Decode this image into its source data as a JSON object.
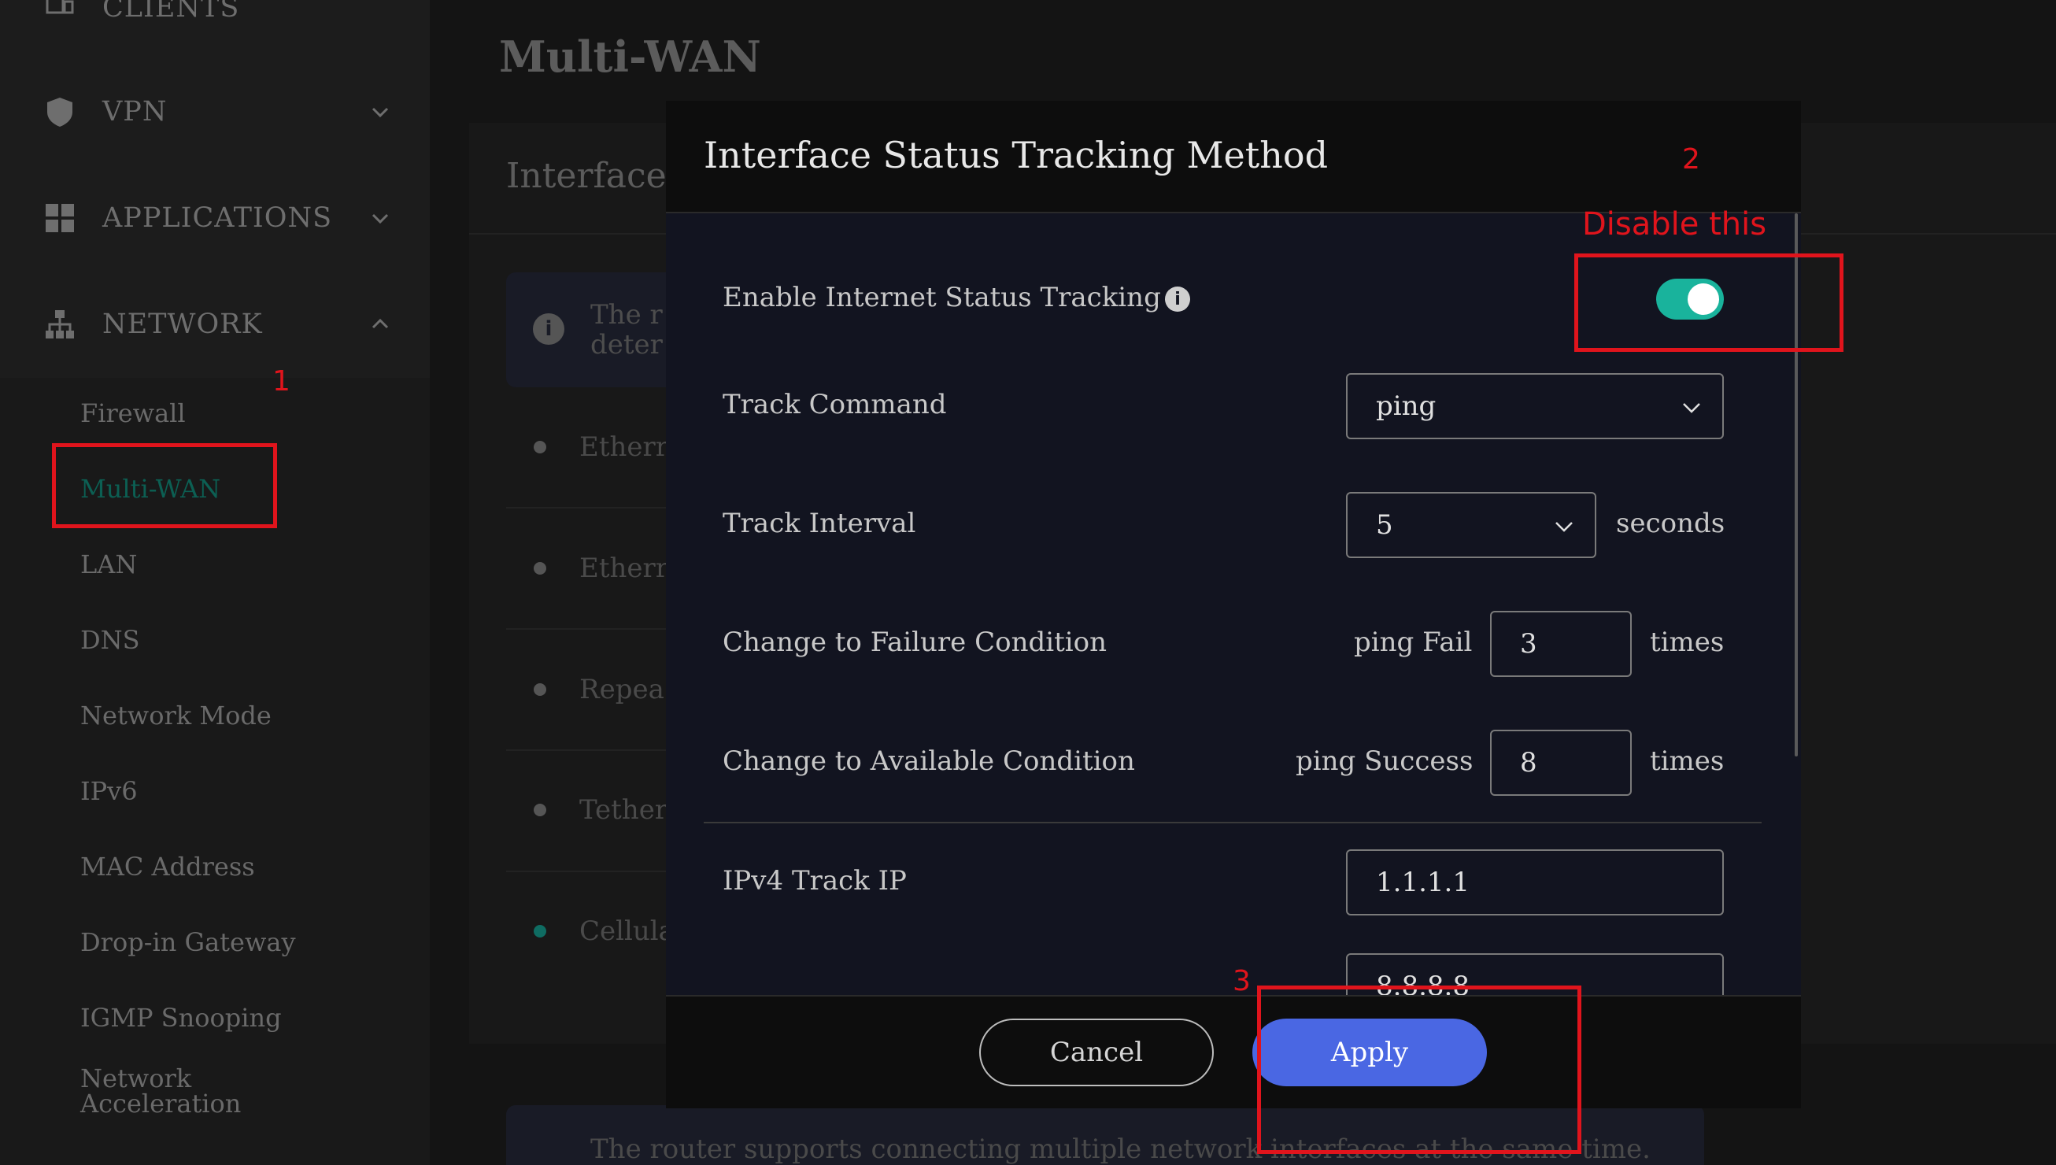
{
  "sidebar": {
    "items": [
      {
        "label": "CLIENTS",
        "icon": "clients-icon"
      },
      {
        "label": "VPN",
        "icon": "shield-icon"
      },
      {
        "label": "APPLICATIONS",
        "icon": "grid-icon"
      },
      {
        "label": "NETWORK",
        "icon": "network-icon"
      }
    ],
    "network_sub": [
      "Firewall",
      "Multi-WAN",
      "LAN",
      "DNS",
      "Network Mode",
      "IPv6",
      "MAC Address",
      "Drop-in Gateway",
      "IGMP Snooping",
      "Network\nAcceleration"
    ]
  },
  "page": {
    "title": "Multi-WAN",
    "panel_title": "Interface",
    "info_text_1": "The r",
    "info_text_2": "deter",
    "rows": [
      "Etherr",
      "Etherr",
      "Repea",
      "Tether",
      "Cellula"
    ],
    "bottom_info": "The router supports connecting multiple network interfaces at the same time."
  },
  "modal": {
    "title": "Interface Status Tracking Method",
    "enable_label": "Enable Internet Status Tracking",
    "enable_on": true,
    "track_command_label": "Track Command",
    "track_command_value": "ping",
    "track_interval_label": "Track Interval",
    "track_interval_value": "5",
    "seconds_label": "seconds",
    "failure_label": "Change to Failure Condition",
    "failure_prefix": "ping Fail",
    "failure_value": "3",
    "available_label": "Change to Available Condition",
    "available_prefix": "ping Success",
    "available_value": "8",
    "times_label": "times",
    "ipv4_label": "IPv4 Track IP",
    "ipv4_value_1": "1.1.1.1",
    "ipv4_value_2": "8.8.8.8",
    "cancel_label": "Cancel",
    "apply_label": "Apply"
  },
  "annotations": {
    "num_1": "1",
    "num_2": "2",
    "num_3": "3",
    "disable_text": "Disable this",
    "color": "#e0141c"
  },
  "colors": {
    "accent_green": "#19b39c",
    "apply_blue": "#4a67e3",
    "active_nav": "#0c5f53"
  }
}
